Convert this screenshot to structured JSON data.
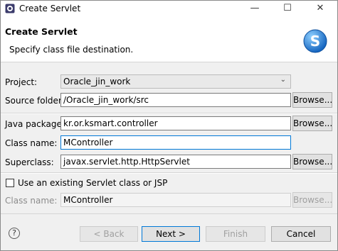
{
  "window": {
    "title": "Create Servlet",
    "minimize": "—",
    "maximize": "☐",
    "close": "✕"
  },
  "header": {
    "title": "Create Servlet",
    "subtitle": "Specify class file destination.",
    "badge_icon": "servlet-logo-icon"
  },
  "form": {
    "project": {
      "label": "Project:",
      "value": "Oracle_jin_work"
    },
    "source_folder": {
      "label": "Source folder:",
      "value": "/Oracle_jin_work/src",
      "button": "Browse..."
    },
    "java_package": {
      "label": "Java package:",
      "value": "kr.or.ksmart.controller",
      "button": "Browse..."
    },
    "class_name": {
      "label": "Class name:",
      "value": "MController"
    },
    "superclass": {
      "label": "Superclass:",
      "value": "javax.servlet.http.HttpServlet",
      "button": "Browse..."
    },
    "use_existing": {
      "label": "Use an existing Servlet class or JSP",
      "checked": false
    },
    "existing_class_name": {
      "label": "Class name:",
      "value": "MController",
      "button": "Browse..."
    }
  },
  "footer": {
    "help_icon": "?",
    "back": "< Back",
    "next": "Next >",
    "finish": "Finish",
    "cancel": "Cancel"
  },
  "colors": {
    "accent": "#0078d7",
    "badge": "#1e88d8"
  }
}
